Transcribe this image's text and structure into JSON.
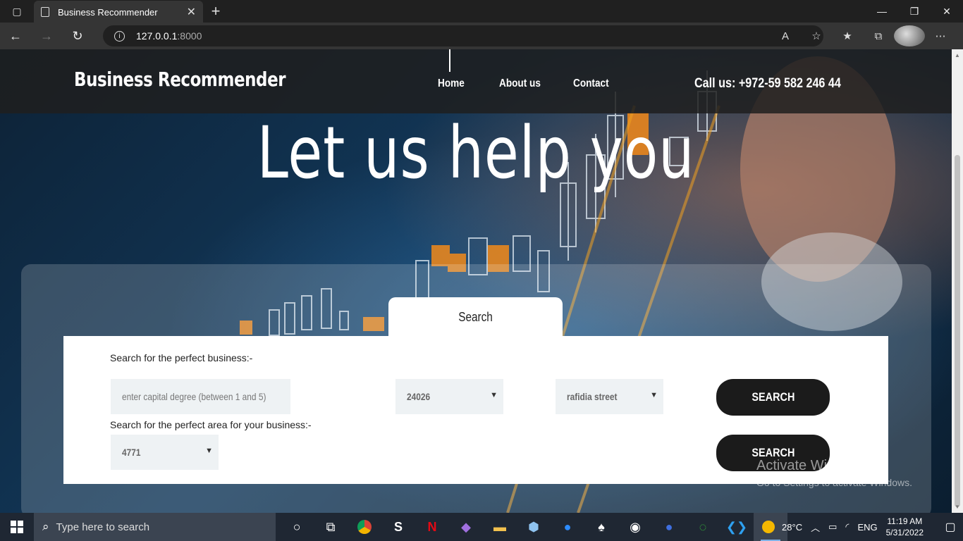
{
  "browser": {
    "tab_title": "Business Recommender",
    "url_host": "127.0.0.1",
    "url_port": ":8000"
  },
  "site": {
    "brand": "Business Recommender",
    "nav": [
      "Home",
      "About us",
      "Contact"
    ],
    "phone": "Call us: +972-59 582 246 44",
    "hero": "Let us help you",
    "search_tab": "Search",
    "form": {
      "business_label": "Search for the perfect business:-",
      "capital_placeholder": "enter capital degree (between 1 and 5)",
      "select_1_value": "24026",
      "select_2_value": "rafidia street",
      "search_button_1": "SEARCH",
      "area_label": "Search for the perfect area for your business:-",
      "select_3_value": "4771",
      "search_button_2": "SEARCH"
    }
  },
  "watermark": {
    "line1": "Activate Windows",
    "line2": "Go to Settings to activate Windows."
  },
  "taskbar": {
    "search_placeholder": "Type here to search",
    "temperature": "28°C",
    "language": "ENG",
    "time": "11:19 AM",
    "date": "5/31/2022"
  }
}
